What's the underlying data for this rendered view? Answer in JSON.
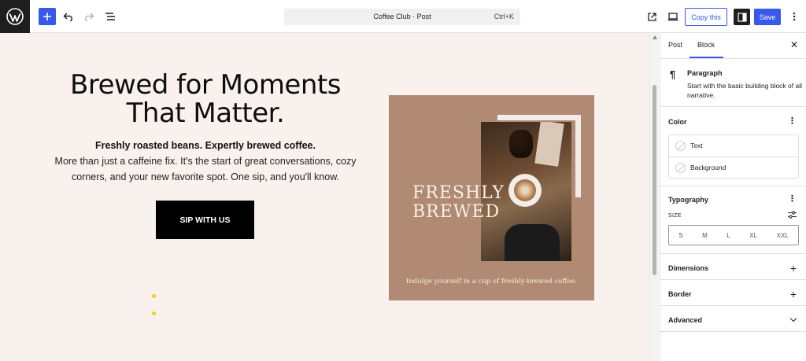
{
  "topbar": {
    "command_title": "Coffee Club · Post",
    "command_shortcut": "Ctrl+K",
    "copy_label": "Copy this",
    "save_label": "Save"
  },
  "canvas": {
    "heading": "Brewed for Moments That Matter.",
    "subheading": "Freshly roasted beans. Expertly brewed coffee.",
    "description": "More than just a caffeine fix. It's the start of great conversations, cozy corners, and your new favorite spot. One sip, and you'll know.",
    "cta_label": "SIP WITH US",
    "promo": {
      "title_line1": "FRESHLY",
      "title_line2": "BREWED",
      "caption": "Indulge yourself in a cup of freshly-brewed coffee."
    }
  },
  "sidebar": {
    "tabs": [
      "Post",
      "Block"
    ],
    "active_tab": "Block",
    "block": {
      "name": "Paragraph",
      "description": "Start with the basic building block of all narrative."
    },
    "panels": {
      "color": {
        "title": "Color",
        "items": [
          "Text",
          "Background"
        ]
      },
      "typography": {
        "title": "Typography",
        "size_label": "SIZE",
        "sizes": [
          "S",
          "M",
          "L",
          "XL",
          "XXL"
        ]
      },
      "dimensions": {
        "title": "Dimensions"
      },
      "border": {
        "title": "Border"
      },
      "advanced": {
        "title": "Advanced"
      }
    }
  },
  "colors": {
    "accent": "#3858e9",
    "canvas_bg": "#f9f1ee",
    "promo_bg": "#b08a72",
    "dark": "#1e1e1e"
  }
}
